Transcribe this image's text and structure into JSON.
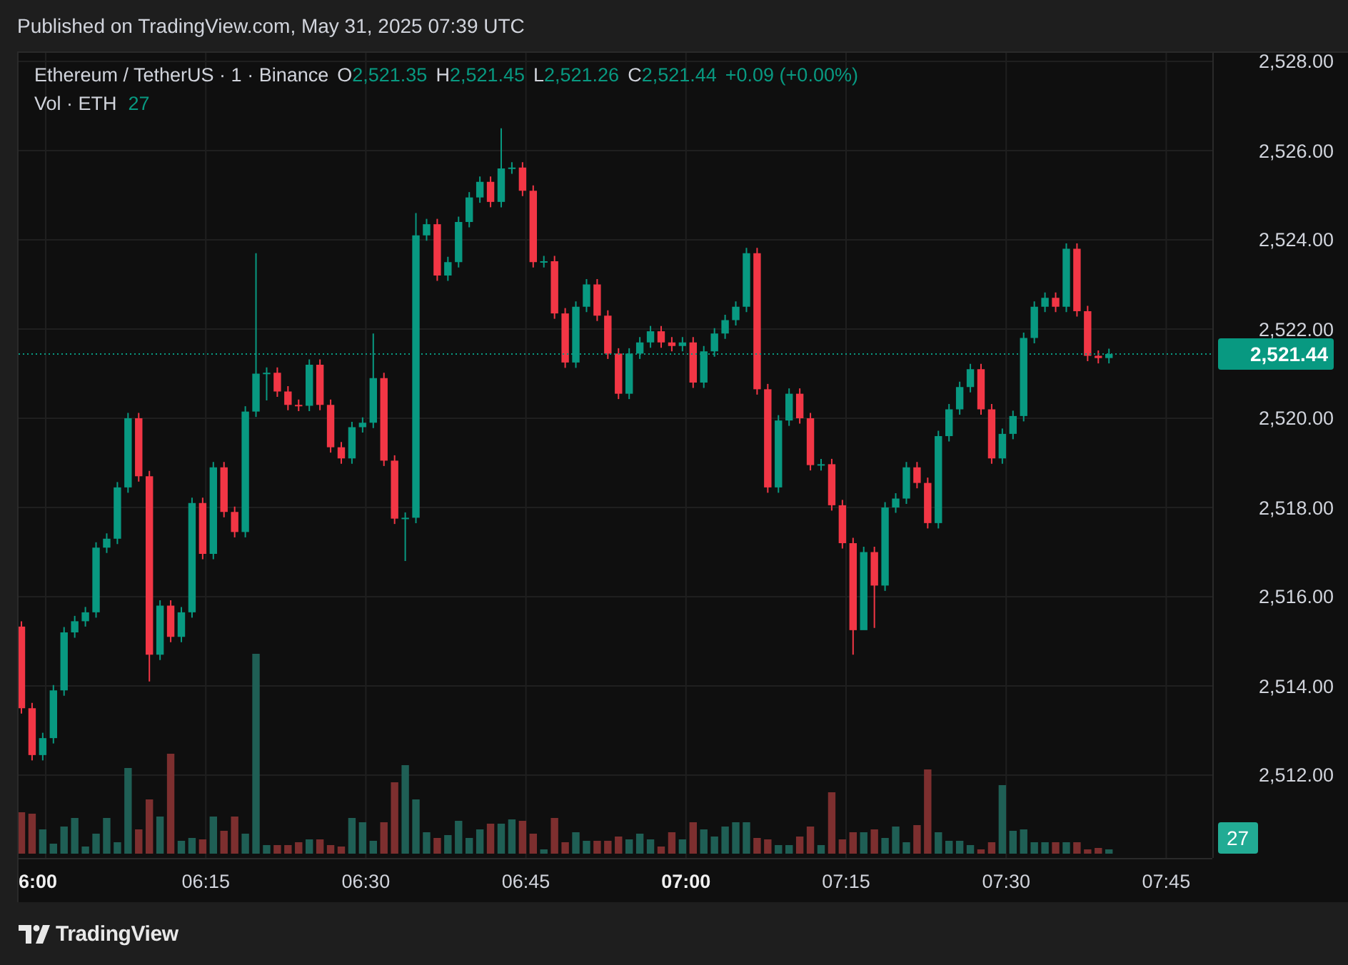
{
  "header": {
    "published": "Published on TradingView.com, May 31, 2025 07:39 UTC"
  },
  "legend": {
    "symbol": "Ethereum / TetherUS · 1 · Binance",
    "ohlc": [
      {
        "label": "O",
        "value": "2,521.35"
      },
      {
        "label": "H",
        "value": "2,521.45"
      },
      {
        "label": "L",
        "value": "2,521.26"
      },
      {
        "label": "C",
        "value": "2,521.44"
      }
    ],
    "change": "+0.09 (+0.00%)",
    "volume_label": "Vol · ETH",
    "volume_value": "27"
  },
  "price_axis": {
    "ticks": [
      "2,528.00",
      "2,526.00",
      "2,524.00",
      "2,522.00",
      "2,520.00",
      "2,518.00",
      "2,516.00",
      "2,514.00",
      "2,512.00"
    ],
    "last_price": "2,521.44",
    "last_volume": "27"
  },
  "time_axis": [
    {
      "label": "6:00",
      "major": true
    },
    {
      "label": "06:15",
      "major": false
    },
    {
      "label": "06:30",
      "major": false
    },
    {
      "label": "06:45",
      "major": false
    },
    {
      "label": "07:00",
      "major": true
    },
    {
      "label": "07:15",
      "major": false
    },
    {
      "label": "07:30",
      "major": false
    },
    {
      "label": "07:45",
      "major": false
    }
  ],
  "footer": {
    "brand": "TradingView"
  }
}
